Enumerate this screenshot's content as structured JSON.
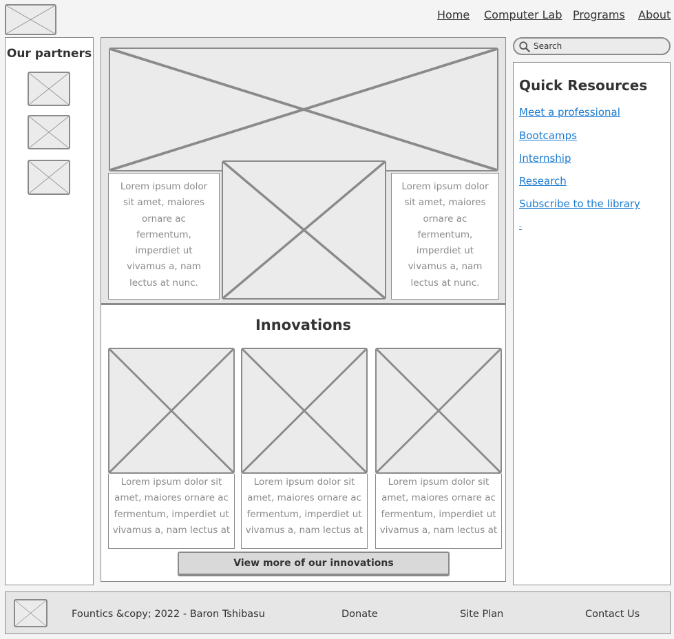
{
  "header": {
    "nav": [
      "Home",
      "Computer Lab",
      "Programs",
      "About"
    ]
  },
  "search": {
    "placeholder": "Search"
  },
  "partners": {
    "title": "Our partners"
  },
  "hero": {
    "left_text": "Lorem ipsum dolor sit amet, maiores ornare ac fermentum, imperdiet ut vivamus a, nam lectus at nunc.",
    "right_text": "Lorem ipsum dolor sit amet, maiores ornare ac fermentum, imperdiet ut vivamus a, nam lectus at nunc."
  },
  "innovations": {
    "title": "Innovations",
    "cards": [
      "Lorem ipsum dolor sit amet, maiores ornare ac fermentum, imperdiet ut vivamus a, nam lectus at",
      "Lorem ipsum dolor sit amet, maiores ornare ac fermentum, imperdiet ut vivamus a, nam lectus at",
      "Lorem ipsum dolor sit amet, maiores ornare ac fermentum, imperdiet ut vivamus a, nam lectus at"
    ],
    "button": "View more of our innovations"
  },
  "quick_resources": {
    "title": "Quick Resources",
    "links": [
      "Meet  a professional",
      "Bootcamps",
      "Internship",
      "Research",
      "Subscribe to the library",
      "-"
    ]
  },
  "footer": {
    "copyright": "Fountics &copy; 2022 - Baron Tshibasu",
    "donate": "Donate",
    "site_plan": "Site Plan",
    "contact": "Contact Us"
  },
  "colors": {
    "link": "#1b7bd1",
    "border": "#8a8a8a",
    "placeholder_fill": "#ebebeb"
  }
}
